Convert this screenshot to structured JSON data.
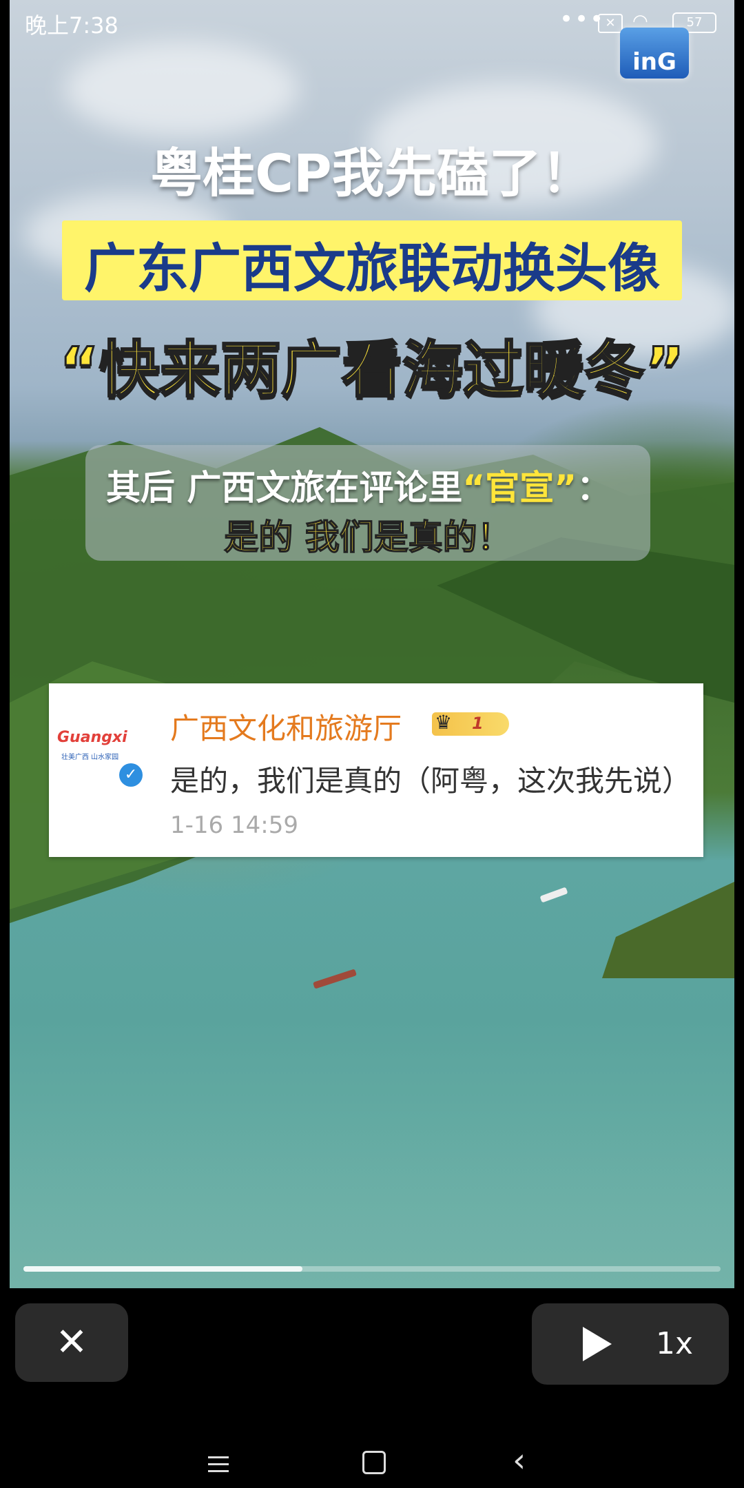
{
  "status_bar": {
    "time": "晚上7:38",
    "dots": "•••",
    "battery": "57"
  },
  "logo": {
    "text": "inG"
  },
  "video": {
    "title_line1": "粤桂CP我先磕了！",
    "title_line2": "广东广西文旅联动换头像",
    "title_line3": "“快来两广看海过暖冬”",
    "subtitle_prefix": "其后 广西文旅在评论里",
    "subtitle_quote": "“官宣”",
    "subtitle_suffix": "：",
    "subtitle_line2": "是的 我们是真的！"
  },
  "comment": {
    "avatar_word": "Guangxi",
    "avatar_tag": "壮美广西 山水家园",
    "name": "广西文化和旅游厅",
    "level": "1",
    "text": "是的，我们是真的（阿粤，这次我先说）",
    "time": "1-16 14:59"
  },
  "controls": {
    "close_icon": "close-icon",
    "play_icon": "play-icon",
    "speed": "1x",
    "progress": 0.4
  },
  "nav": {
    "back_glyph": "‹"
  }
}
